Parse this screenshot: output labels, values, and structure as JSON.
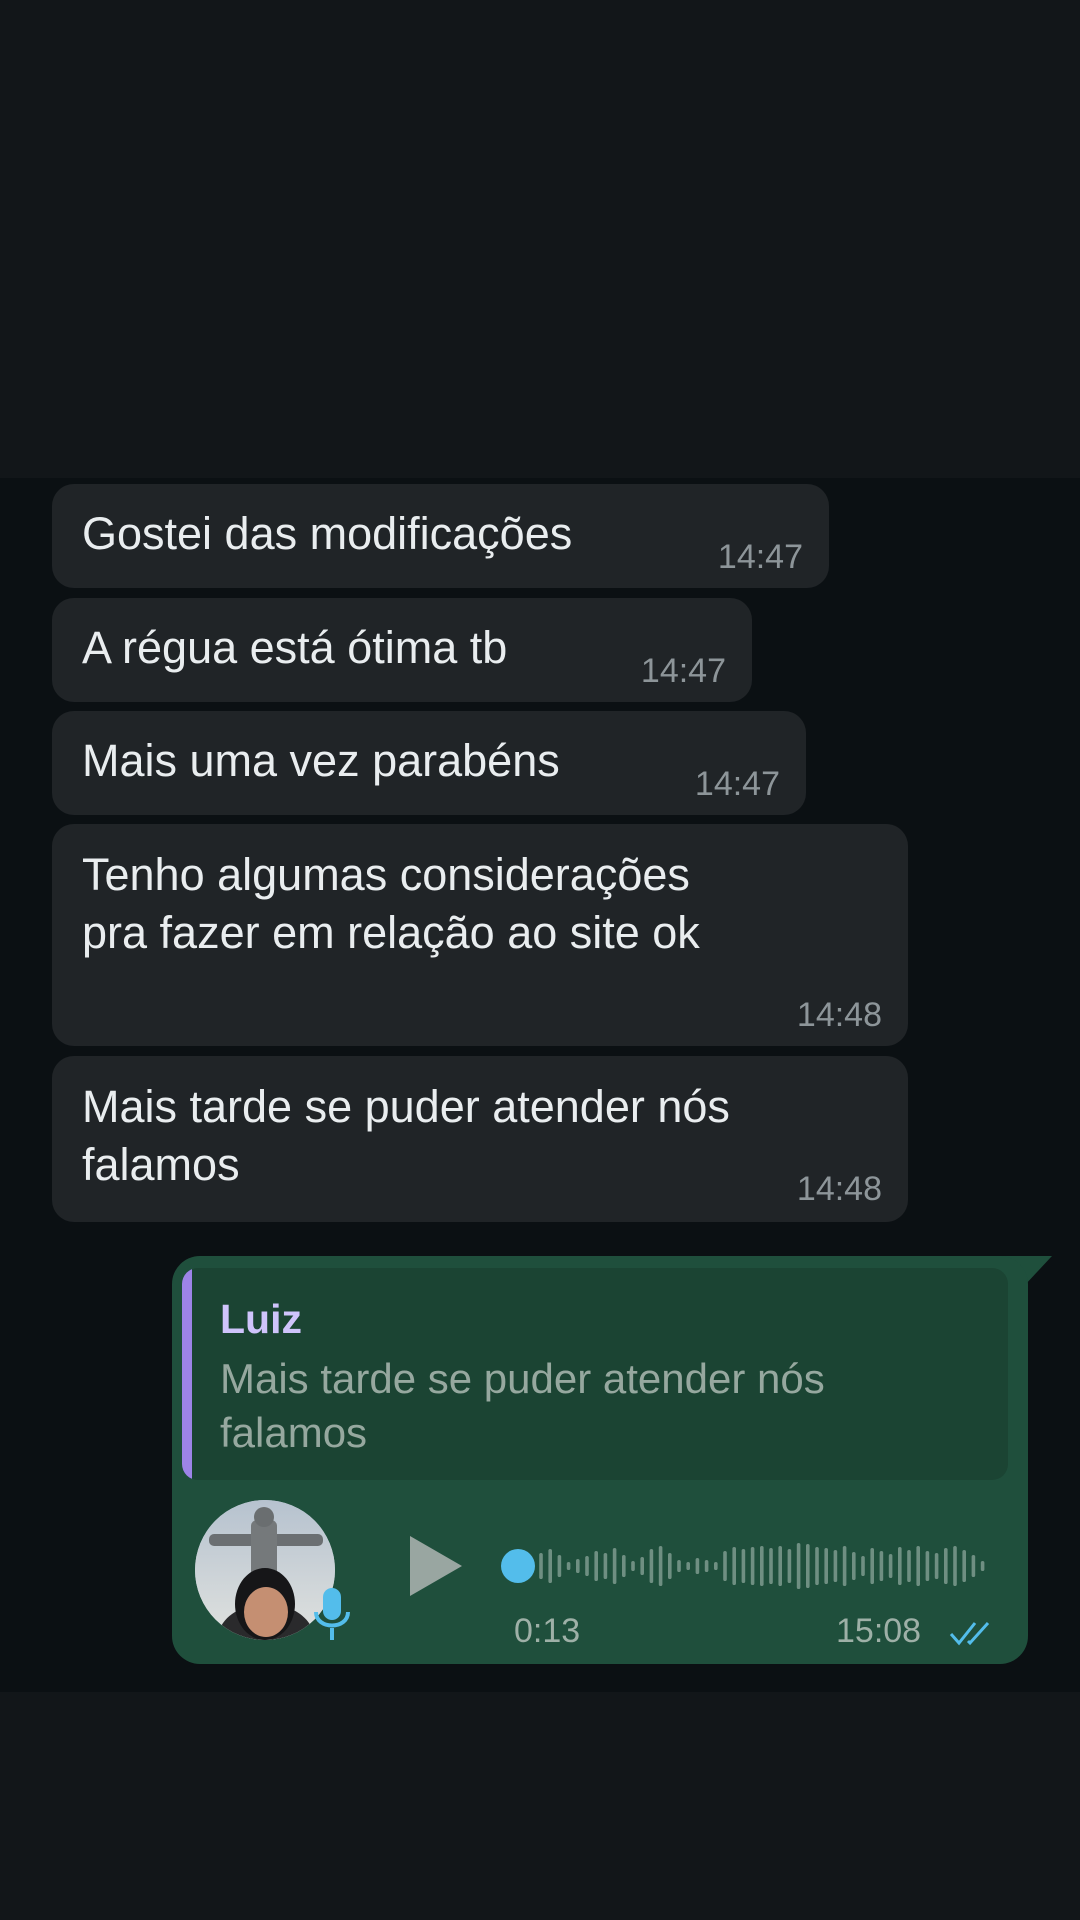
{
  "messages_in": [
    {
      "text": "Gostei das modificações",
      "time": "14:47"
    },
    {
      "text": "A régua está ótima tb",
      "time": "14:47"
    },
    {
      "text": "Mais uma vez parabéns",
      "time": "14:47"
    },
    {
      "line1": "Tenho algumas considerações",
      "line2": "pra fazer em relação ao site ok",
      "time": "14:48"
    },
    {
      "line1": "Mais tarde se puder atender nós",
      "line2": "falamos",
      "time": "14:48"
    }
  ],
  "reply": {
    "quote_author": "Luiz",
    "quote_text": "Mais tarde se puder atender nós falamos",
    "audio_duration": "0:13",
    "time": "15:08",
    "status": "read",
    "progress": 0
  },
  "icons": [
    "play-icon",
    "mic-icon",
    "double-check-icon"
  ],
  "colors": {
    "incoming_bubble": "#202427",
    "outgoing_bubble": "#1f4f3c",
    "quote_accent": "#9d84e8",
    "tick_blue": "#53bdeb",
    "progress_dot": "#53bdeb"
  }
}
